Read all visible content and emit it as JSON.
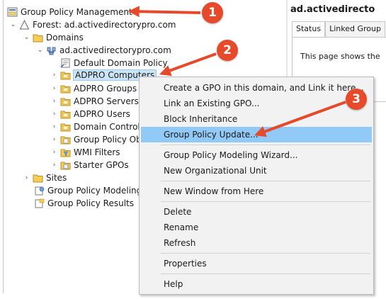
{
  "tree": {
    "root": "Group Policy Management",
    "forest": "Forest: ad.activedirectorypro.com",
    "domains": "Domains",
    "domain": "ad.activedirectorypro.com",
    "default_policy": "Default Domain Policy",
    "adpro_computers": "ADPRO Computers",
    "adpro_groups": "ADPRO Groups",
    "adpro_servers": "ADPRO Servers",
    "adpro_users": "ADPRO Users",
    "domain_controllers": "Domain Control",
    "gpo_objects": "Group Policy Ob",
    "wmi_filters": "WMI Filters",
    "starter_gpos": "Starter GPOs",
    "sites": "Sites",
    "modeling": "Group Policy Modeling",
    "results": "Group Policy Results"
  },
  "right_pane": {
    "title": "ad.activedirecto",
    "tab_status": "Status",
    "tab_linked": "Linked Group",
    "body_text": "This page shows the"
  },
  "context_menu": {
    "create_gpo": "Create a GPO in this domain, and Link it here...",
    "link_existing": "Link an Existing GPO...",
    "block_inheritance": "Block Inheritance",
    "gp_update": "Group Policy Update...",
    "modeling_wizard": "Group Policy Modeling Wizard...",
    "new_ou": "New Organizational Unit",
    "new_window": "New Window from Here",
    "delete": "Delete",
    "rename": "Rename",
    "refresh": "Refresh",
    "properties": "Properties",
    "help": "Help"
  },
  "badges": {
    "one": "1",
    "two": "2",
    "three": "3"
  },
  "colors": {
    "badge": "#e74a2a",
    "highlight": "#91c9f7",
    "selection": "#cce4f7"
  }
}
